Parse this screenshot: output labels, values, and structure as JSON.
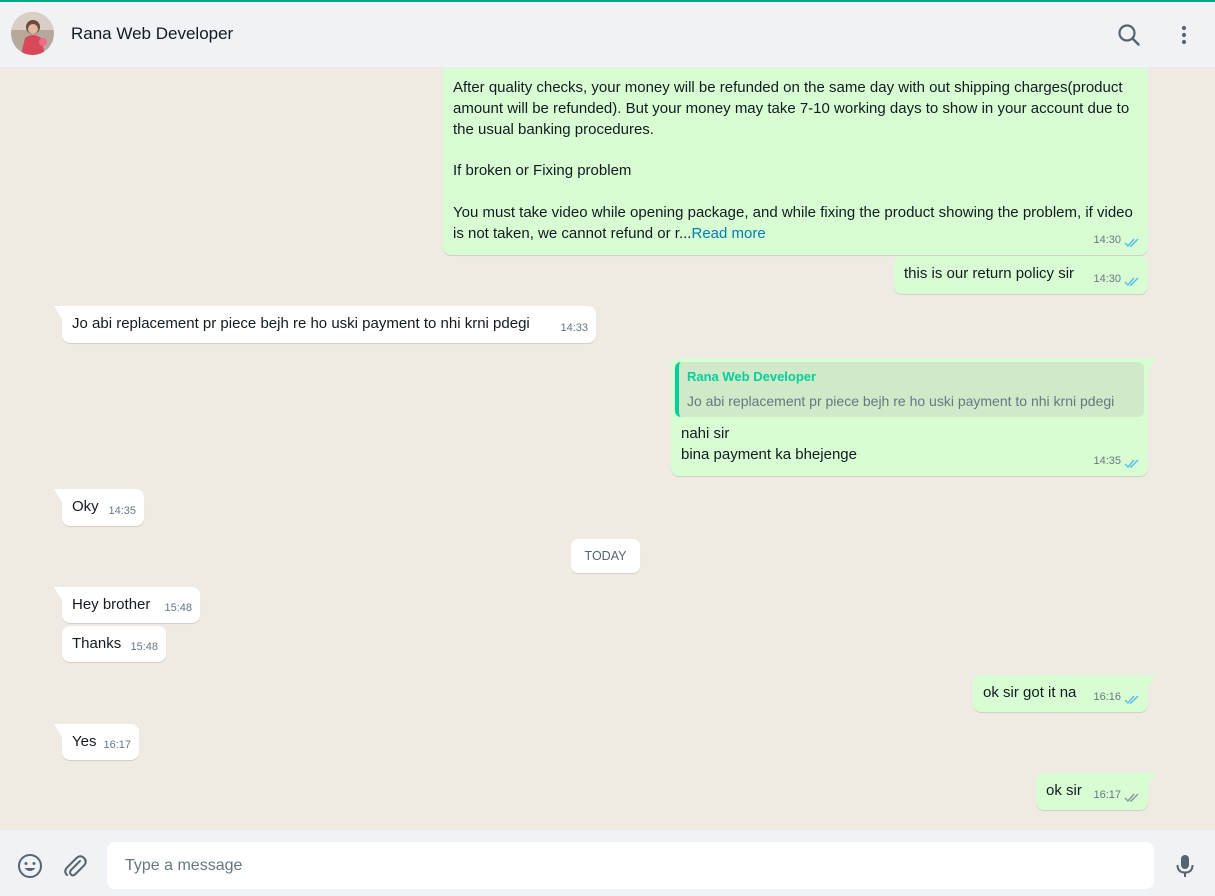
{
  "header": {
    "contact_name": "Rana Web Developer",
    "icons": [
      "search-icon",
      "menu-icon"
    ]
  },
  "messages": [
    {
      "direction": "out",
      "paragraphs": [
        "After quality checks, your money will be refunded on the same day with out shipping charges(product amount will be refunded). But your money may take 7-10 working days to show in your account due to the usual banking procedures.",
        "If broken or Fixing problem",
        "You must take video while opening package, and while fixing the product showing the problem, if video is not taken, we cannot refund or r..."
      ],
      "read_more": "Read more",
      "time": "14:30",
      "status": "read"
    },
    {
      "direction": "out",
      "text": "this is our return policy sir",
      "time": "14:30",
      "status": "read"
    },
    {
      "direction": "in",
      "text": "Jo abi replacement pr piece bejh re ho uski payment to nhi krni pdegi",
      "time": "14:33"
    },
    {
      "direction": "out",
      "quote": {
        "author": "Rana Web Developer",
        "text": "Jo abi replacement pr piece bejh re ho uski payment to nhi krni pdegi"
      },
      "lines": [
        "nahi sir",
        "bina payment ka bhejenge"
      ],
      "time": "14:35",
      "status": "read"
    },
    {
      "direction": "in",
      "text": "Oky",
      "time": "14:35"
    },
    {
      "direction": "in",
      "text": "Hey brother",
      "time": "15:48"
    },
    {
      "direction": "in",
      "text": "Thanks",
      "time": "15:48"
    },
    {
      "direction": "out",
      "text": "ok sir got it na",
      "time": "16:16",
      "status": "read"
    },
    {
      "direction": "in",
      "text": "Yes",
      "time": "16:17"
    },
    {
      "direction": "out",
      "text": "ok sir",
      "time": "16:17",
      "status": "delivered"
    }
  ],
  "date_divider": "TODAY",
  "composer": {
    "placeholder": "Type a message",
    "icons": [
      "emoji-icon",
      "attach-icon",
      "mic-icon"
    ]
  },
  "colors": {
    "accent": "#00a884",
    "outgoing_bubble": "#d9fdd3",
    "incoming_bubble": "#ffffff",
    "chat_background": "#efeae2",
    "read_tick": "#53bdeb",
    "delivered_tick": "#8696a0",
    "link": "#027eb5"
  }
}
